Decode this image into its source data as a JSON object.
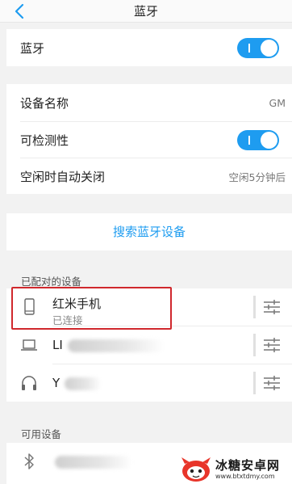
{
  "header": {
    "title": "蓝牙"
  },
  "bluetooth": {
    "label": "蓝牙",
    "enabled": true
  },
  "settings": {
    "device_name_label": "设备名称",
    "device_name_value": "GM",
    "discoverable_label": "可检测性",
    "discoverable_enabled": true,
    "auto_off_label": "空闲时自动关闭",
    "auto_off_value": "空闲5分钟后"
  },
  "search": {
    "label": "搜索蓝牙设备"
  },
  "paired": {
    "header": "已配对的设备",
    "devices": [
      {
        "name": "红米手机",
        "status": "已连接",
        "icon": "phone-icon"
      },
      {
        "name": "LI",
        "status": "",
        "icon": "laptop-icon"
      },
      {
        "name": "Y",
        "status": "",
        "icon": "headphones-icon"
      }
    ]
  },
  "available": {
    "header": "可用设备",
    "devices": [
      {
        "name": "",
        "icon": "bluetooth-icon"
      }
    ]
  },
  "watermark": {
    "text": "冰糖安卓网",
    "url": "www.btxtdmy.com"
  },
  "colors": {
    "accent": "#1e9cf0",
    "highlight": "#d0282d",
    "background": "#f2f2f2"
  }
}
